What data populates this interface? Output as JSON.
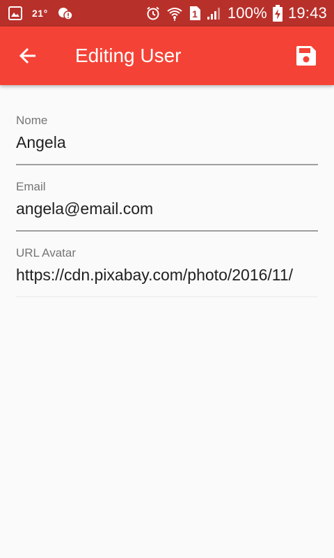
{
  "status_bar": {
    "temperature": "21°",
    "battery": "100%",
    "time": "19:43",
    "sim_number": "1",
    "icons": [
      "gallery-icon",
      "weather-icon",
      "cloud-alert-icon",
      "alarm-icon",
      "wifi-icon",
      "sim-icon",
      "signal-icon",
      "battery-charging-icon"
    ]
  },
  "app_bar": {
    "title": "Editing User",
    "back_icon": "arrow-back-icon",
    "save_icon": "save-icon",
    "color": "#f44336"
  },
  "form": {
    "fields": [
      {
        "label": "Nome",
        "value": "Angela"
      },
      {
        "label": "Email",
        "value": "angela@email.com"
      },
      {
        "label": "URL Avatar",
        "value": "https://cdn.pixabay.com/photo/2016/11/"
      }
    ]
  }
}
